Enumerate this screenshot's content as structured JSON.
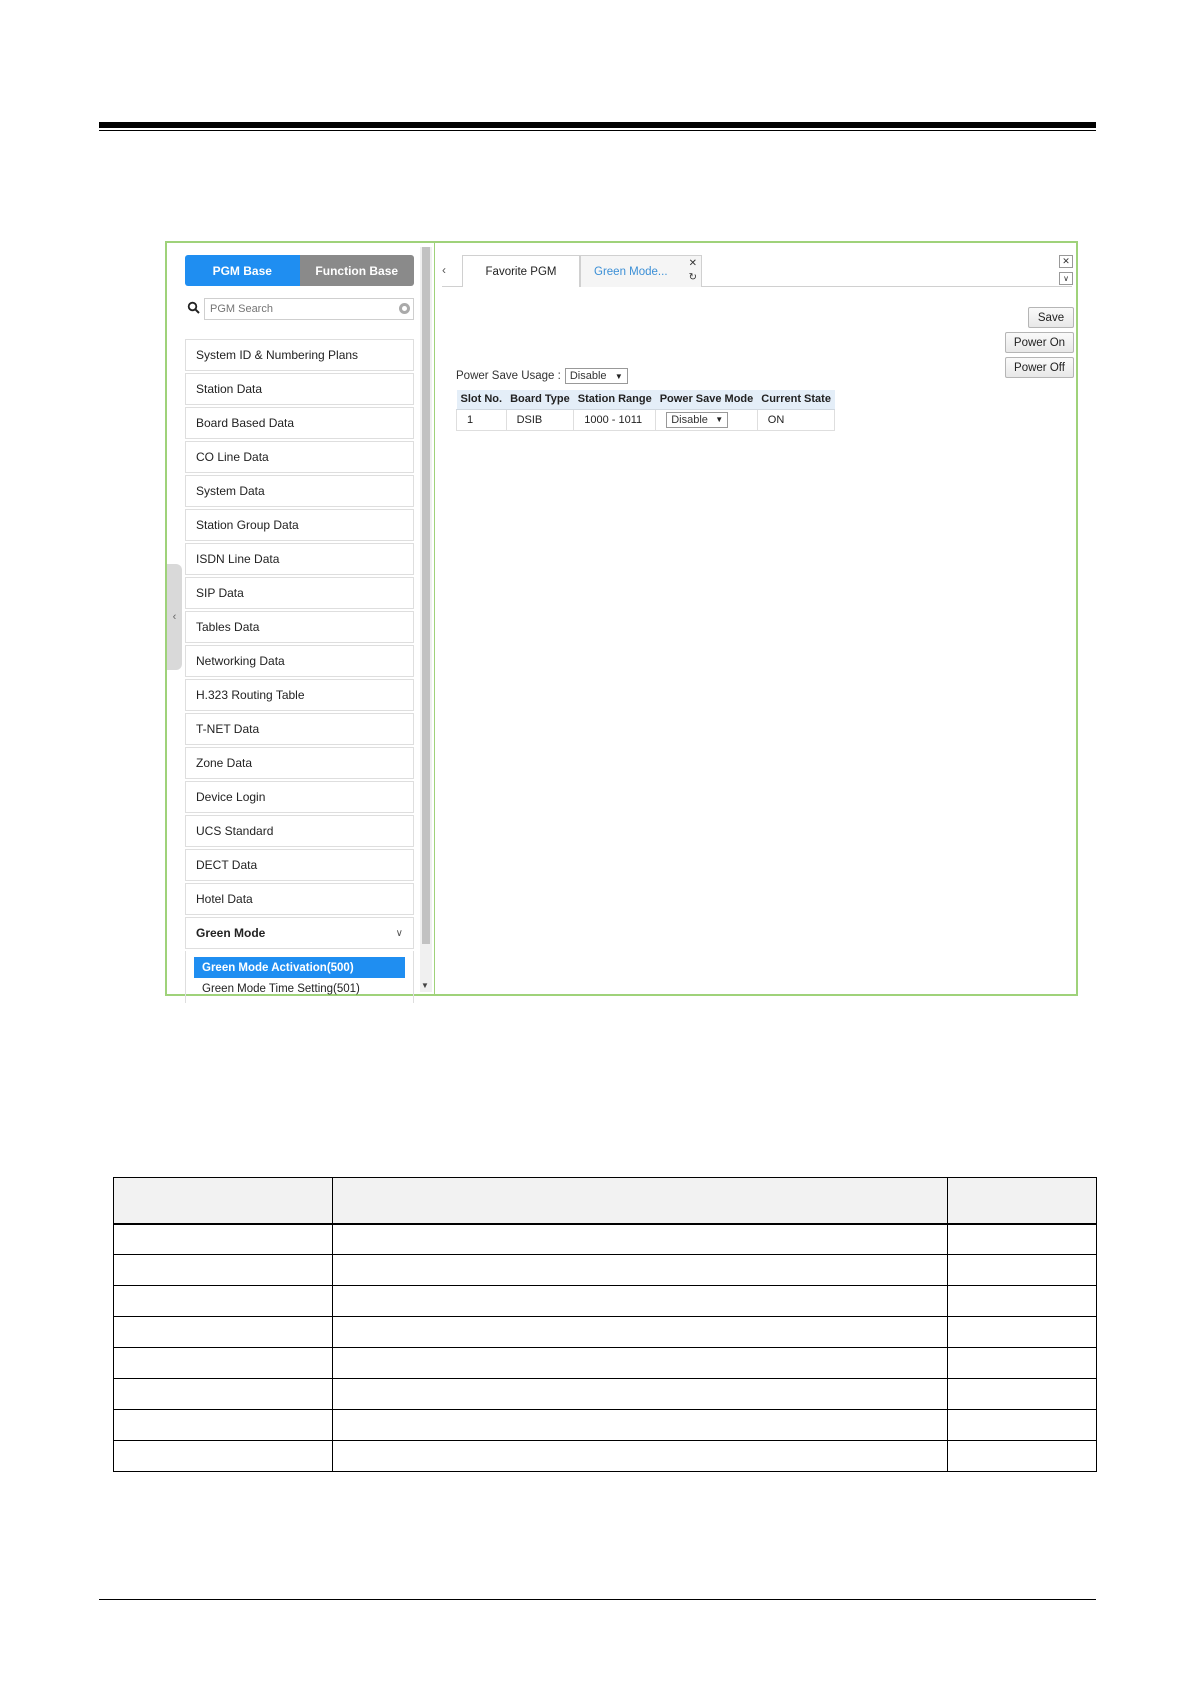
{
  "left_panel": {
    "pgm_base_label": "PGM Base",
    "function_base_label": "Function Base",
    "search_placeholder": "PGM Search",
    "menu_items": [
      "System ID & Numbering Plans",
      "Station Data",
      "Board Based Data",
      "CO Line Data",
      "System Data",
      "Station Group Data",
      "ISDN Line Data",
      "SIP Data",
      "Tables Data",
      "Networking Data",
      "H.323 Routing Table",
      "T-NET Data",
      "Zone Data",
      "Device Login",
      "UCS Standard",
      "DECT Data",
      "Hotel Data"
    ],
    "expanded_item": {
      "label": "Green Mode",
      "children": [
        "Green Mode Activation(500)",
        "Green Mode Time Setting(501)"
      ]
    }
  },
  "tabs": {
    "favorite_label": "Favorite PGM",
    "active_label": "Green Mode..."
  },
  "buttons": {
    "save": "Save",
    "power_on": "Power On",
    "power_off": "Power Off"
  },
  "power_save_usage": {
    "label": "Power Save Usage :",
    "value": "Disable"
  },
  "table": {
    "headers": [
      "Slot No.",
      "Board Type",
      "Station Range",
      "Power Save Mode",
      "Current State"
    ],
    "rows": [
      {
        "slot": "1",
        "board_type": "DSIB",
        "station_range": "1000 - 1011",
        "power_save_mode": "Disable",
        "current_state": "ON"
      }
    ]
  },
  "icons": {
    "search": "search-icon",
    "clear": "clear-icon",
    "close": "close-icon",
    "refresh": "refresh-icon",
    "chevron_down": "chevron-down-icon",
    "chevron_left": "chevron-left-icon"
  },
  "colors": {
    "accent": "#1f8ef1",
    "frame_border": "#9fd27a",
    "tab_active_text": "#3b8fd6"
  }
}
